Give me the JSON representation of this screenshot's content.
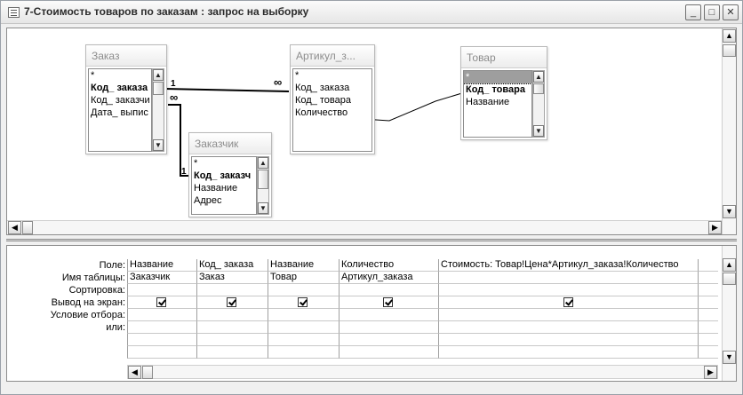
{
  "window": {
    "title": "7-Стоимость товаров по заказам : запрос на выборку",
    "controls": {
      "minimize": "_",
      "maximize": "□",
      "close": "✕"
    }
  },
  "tables": [
    {
      "name": "Заказ",
      "fields": [
        "*",
        "Код_ заказа",
        "Код_ заказчи",
        "Дата_ выпис"
      ]
    },
    {
      "name": "Артикул_з...",
      "fields": [
        "*",
        "Код_ заказа",
        "Код_ товара",
        "Количество"
      ]
    },
    {
      "name": "Товар",
      "fields": [
        "*",
        "Код_ товара",
        "Название"
      ]
    },
    {
      "name": "Заказчик",
      "fields": [
        "*",
        "Код_ заказч",
        "Название",
        "Адрес"
      ]
    }
  ],
  "relations": {
    "one": "1",
    "many": "∞"
  },
  "grid": {
    "row_labels": [
      "Поле:",
      "Имя таблицы:",
      "Сортировка:",
      "Вывод на экран:",
      "Условие отбора:",
      "или:"
    ],
    "columns": [
      {
        "field": "Название",
        "table": "Заказчик",
        "show": true
      },
      {
        "field": "Код_ заказа",
        "table": "Заказ",
        "show": true
      },
      {
        "field": "Название",
        "table": "Товар",
        "show": true
      },
      {
        "field": "Количество",
        "table": "Артикул_заказа",
        "show": true
      },
      {
        "field": "Стоимость: Товар!Цена*Артикул_заказа!Количество",
        "table": "",
        "show": true
      },
      {
        "field": "",
        "table": "",
        "show": false
      }
    ]
  }
}
